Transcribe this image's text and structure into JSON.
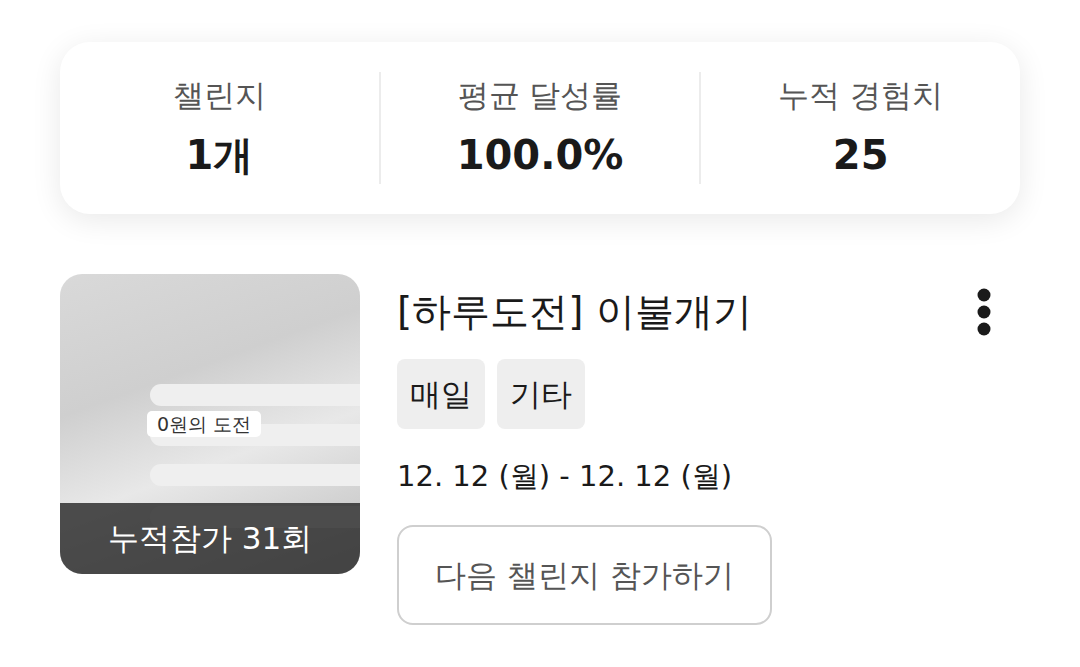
{
  "stats": [
    {
      "label": "챌린지",
      "value": "1개"
    },
    {
      "label": "평균 달성률",
      "value": "100.0%"
    },
    {
      "label": "누적 경험치",
      "value": "25"
    }
  ],
  "challenge": {
    "badge": "0원의 도전",
    "participation": "누적참가 31회",
    "title": "[하루도전] 이불개기",
    "tags": [
      "매일",
      "기타"
    ],
    "period": "12. 12 (월) - 12. 12 (월)",
    "button": "다음 챌린지 참가하기"
  }
}
